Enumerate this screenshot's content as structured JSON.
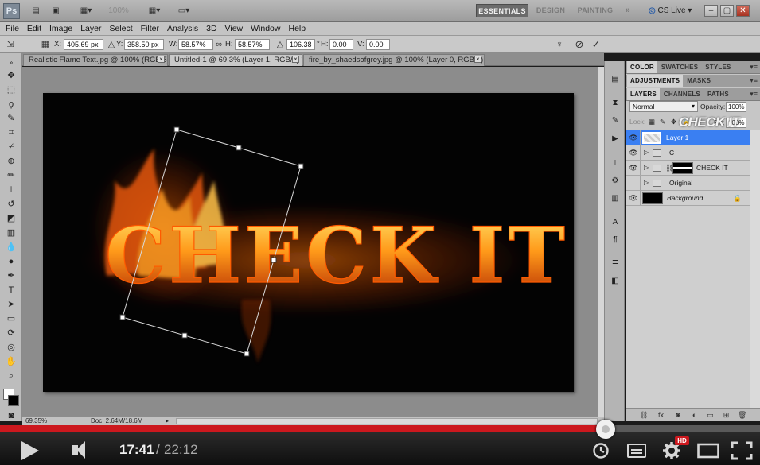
{
  "app": {
    "logo": "Ps",
    "workspaces": {
      "active": "ESSENTIALS",
      "design": "DESIGN",
      "painting": "PAINTING",
      "more": "»"
    },
    "cs_live": "CS Live ▾",
    "zoom_dropdown": "100%",
    "window_controls": {
      "minimize": "–",
      "restore": "▢",
      "close": "✕"
    }
  },
  "menu": [
    "File",
    "Edit",
    "Image",
    "Layer",
    "Select",
    "Filter",
    "Analysis",
    "3D",
    "View",
    "Window",
    "Help"
  ],
  "options_bar": {
    "x_label": "X:",
    "x_value": "405.69 px",
    "y_label": "Y:",
    "y_value": "358.50 px",
    "w_label": "W:",
    "w_value": "58.57%",
    "h_label": "H:",
    "h_value": "58.57%",
    "angle_value": "106.38",
    "angle_unit": "°",
    "hskew_label": "H:",
    "hskew_value": "0.00",
    "vskew_label": "V:",
    "vskew_value": "0.00",
    "cancel_icon": "⊘",
    "commit_icon": "✓"
  },
  "doc_tabs": [
    {
      "label": "Realistic Flame Text.jpg @ 100% (RGB/8)",
      "close": "×"
    },
    {
      "label": "Untitled-1 @ 69.3% (Layer 1, RGB/8) *",
      "close": "×",
      "active": true
    },
    {
      "label": "fire_by_shaedsofgrey.jpg @ 100% (Layer 0, RGB/8) *",
      "close": "×"
    }
  ],
  "canvas": {
    "artwork_text": "CHECK IT"
  },
  "status": {
    "zoom": "69.35%",
    "doc_size": "Doc: 2.64M/18.6M",
    "arrow": "▸"
  },
  "panels": {
    "group1_tabs": [
      "COLOR",
      "SWATCHES",
      "STYLES"
    ],
    "group2_tabs": [
      "ADJUSTMENTS",
      "MASKS"
    ],
    "group3_tabs": [
      "LAYERS",
      "CHANNELS",
      "PATHS"
    ],
    "menu_icon": "▾≡",
    "blend_mode": "Normal",
    "opacity_label": "Opacity:",
    "opacity_value": "100%",
    "lock_label": "Lock:",
    "fill_label": "Fill:",
    "fill_value": "100%",
    "watermark": "CHECK IT"
  },
  "layers": [
    {
      "name": "Layer 1",
      "selected": true,
      "visible": true
    },
    {
      "name": "C",
      "type": "group",
      "visible": true
    },
    {
      "name": "CHECK IT",
      "type": "group-mask",
      "visible": true
    },
    {
      "name": "Original",
      "type": "group",
      "visible": false
    },
    {
      "name": "Background",
      "type": "background",
      "visible": true,
      "locked": true
    }
  ],
  "player": {
    "current_time": "17:41",
    "separator": "/",
    "total_time": "22:12",
    "progress": 0.7966,
    "hd_badge": "HD",
    "colors": {
      "progress": "#cc181e",
      "bar": "#1b1b1b"
    }
  }
}
